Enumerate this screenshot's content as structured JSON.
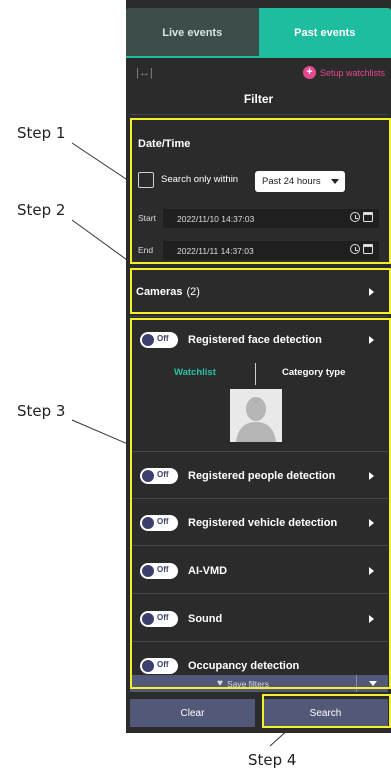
{
  "tabs": {
    "live_label": "Live events",
    "past_label": "Past events"
  },
  "header": {
    "setup_watchlists": "Setup watchlists",
    "filter_title": "Filter"
  },
  "datetime": {
    "title": "Date/Time",
    "search_only_within": "Search only within",
    "range_value": "Past 24 hours",
    "start_label": "Start",
    "start_value": "2022/11/10   14:37:03",
    "end_label": "End",
    "end_value": "2022/11/11   14:37:03"
  },
  "cameras": {
    "label": "Cameras",
    "count": "(2)"
  },
  "toggle_off_text": "Off",
  "detections": [
    {
      "label": "Registered face detection"
    },
    {
      "label": "Registered people detection"
    },
    {
      "label": "Registered vehicle detection"
    },
    {
      "label": "AI-VMD"
    },
    {
      "label": "Sound"
    },
    {
      "label": "Occupancy detection"
    }
  ],
  "watchlist": {
    "tab_watchlist": "Watchlist",
    "tab_category": "Category type"
  },
  "footer": {
    "save_filters": "Save filters",
    "clear": "Clear",
    "search": "Search"
  },
  "steps": {
    "step1": "Step 1",
    "step2": "Step 2",
    "step3": "Step 3",
    "step4": "Step 4"
  },
  "colors": {
    "accent_teal": "#1fbda0",
    "highlight_yellow": "#f4ee2c",
    "watchlist_pink": "#e6478e",
    "button_slate": "#525877"
  }
}
